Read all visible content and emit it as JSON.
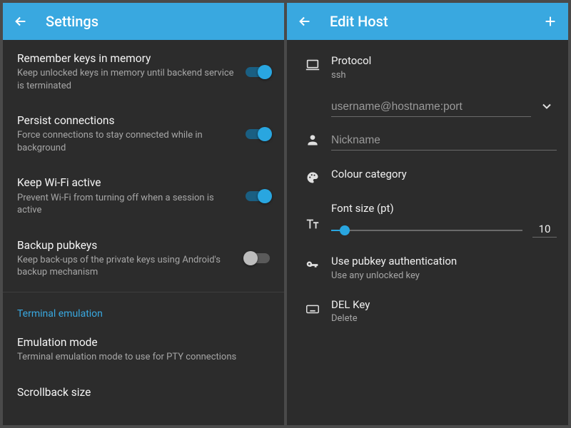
{
  "left": {
    "appbar": {
      "title": "Settings"
    },
    "items": [
      {
        "title": "Remember keys in memory",
        "sub": "Keep unlocked keys in memory until backend service is terminated",
        "on": true
      },
      {
        "title": "Persist connections",
        "sub": "Force connections to stay connected while in background",
        "on": true
      },
      {
        "title": "Keep Wi-Fi active",
        "sub": "Prevent Wi-Fi from turning off when a session is active",
        "on": true
      },
      {
        "title": "Backup pubkeys",
        "sub": "Keep back-ups of the private keys using Android's backup mechanism",
        "on": false
      }
    ],
    "section": "Terminal emulation",
    "emu": {
      "title": "Emulation mode",
      "sub": "Terminal emulation mode to use for PTY connections"
    },
    "scrollback": {
      "title": "Scrollback size"
    }
  },
  "right": {
    "appbar": {
      "title": "Edit Host"
    },
    "protocol": {
      "label": "Protocol",
      "value": "ssh"
    },
    "connection": {
      "placeholder": "username@hostname:port"
    },
    "nickname": {
      "placeholder": "Nickname"
    },
    "colour": {
      "label": "Colour category"
    },
    "font": {
      "label": "Font size (pt)",
      "value": "10",
      "percent": 7
    },
    "pubkey": {
      "label": "Use pubkey authentication",
      "value": "Use any unlocked key"
    },
    "delkey": {
      "label": "DEL Key",
      "value": "Delete"
    }
  }
}
